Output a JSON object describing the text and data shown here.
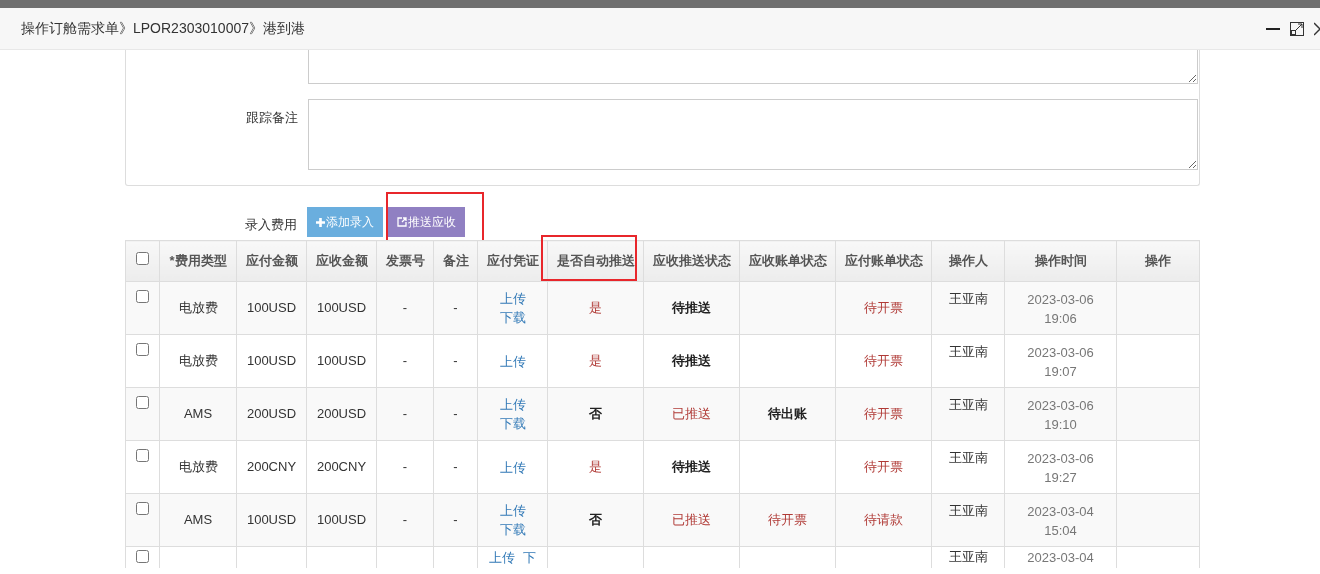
{
  "window": {
    "title": "操作订舱需求单》LPOR2303010007》港到港"
  },
  "form": {
    "tracking_note_label": "跟踪备注"
  },
  "fees": {
    "label": "录入费用",
    "buttons": [
      {
        "kind": "add",
        "label": "添加录入"
      },
      {
        "kind": "push",
        "label": "推送应收"
      }
    ],
    "columns": [
      "*费用类型",
      "应付金额",
      "应收金额",
      "发票号",
      "备注",
      "应付凭证",
      "是否自动推送",
      "应收推送状态",
      "应收账单状态",
      "应付账单状态",
      "操作人",
      "操作时间",
      "操作"
    ],
    "header_checked": false,
    "rows": [
      {
        "checked": false,
        "fee_type": "电放费",
        "payable": "100USD",
        "receivable": "100USD",
        "invoice_no": "-",
        "remark": "-",
        "voucher_links": [
          "上传",
          "下载"
        ],
        "auto_push": {
          "text": "是",
          "kind": "red"
        },
        "push_status": {
          "text": "待推送",
          "kind": "bold"
        },
        "payable_bill": {
          "text": "待开票",
          "kind": "red"
        },
        "operator": "王亚南",
        "time": "2023-03-06 19:06"
      },
      {
        "checked": false,
        "fee_type": "电放费",
        "payable": "100USD",
        "receivable": "100USD",
        "invoice_no": "-",
        "remark": "-",
        "voucher_links": [
          "上传"
        ],
        "auto_push": {
          "text": "是",
          "kind": "red"
        },
        "push_status": {
          "text": "待推送",
          "kind": "bold"
        },
        "payable_bill": {
          "text": "待开票",
          "kind": "red"
        },
        "operator": "王亚南",
        "time": "2023-03-06 19:07"
      },
      {
        "checked": false,
        "fee_type": "AMS",
        "payable": "200USD",
        "receivable": "200USD",
        "invoice_no": "-",
        "remark": "-",
        "voucher_links": [
          "上传",
          "下载"
        ],
        "auto_push": {
          "text": "否",
          "kind": "bold"
        },
        "push_status": {
          "text": "已推送",
          "kind": "red"
        },
        "receivable_bill": {
          "text": "待出账",
          "kind": "bold"
        },
        "payable_bill": {
          "text": "待开票",
          "kind": "red"
        },
        "operator": "王亚南",
        "time": "2023-03-06 19:10"
      },
      {
        "checked": false,
        "fee_type": "电放费",
        "payable": "200CNY",
        "receivable": "200CNY",
        "invoice_no": "-",
        "remark": "-",
        "voucher_links": [
          "上传"
        ],
        "auto_push": {
          "text": "是",
          "kind": "red"
        },
        "push_status": {
          "text": "待推送",
          "kind": "bold"
        },
        "payable_bill": {
          "text": "待开票",
          "kind": "red"
        },
        "operator": "王亚南",
        "time": "2023-03-06 19:27"
      },
      {
        "checked": false,
        "fee_type": "AMS",
        "payable": "100USD",
        "receivable": "100USD",
        "invoice_no": "-",
        "remark": "-",
        "voucher_links": [
          "上传",
          "下载"
        ],
        "auto_push": {
          "text": "否",
          "kind": "bold"
        },
        "push_status": {
          "text": "已推送",
          "kind": "red"
        },
        "receivable_bill": {
          "text": "待开票",
          "kind": "red"
        },
        "payable_bill": {
          "text": "待请款",
          "kind": "red"
        },
        "operator": "王亚南",
        "time": "2023-03-04 15:04"
      },
      {
        "checked": false,
        "voucher_links": [
          "上传",
          "下"
        ],
        "operator": "王亚南",
        "time": "2023-03-04"
      }
    ]
  }
}
